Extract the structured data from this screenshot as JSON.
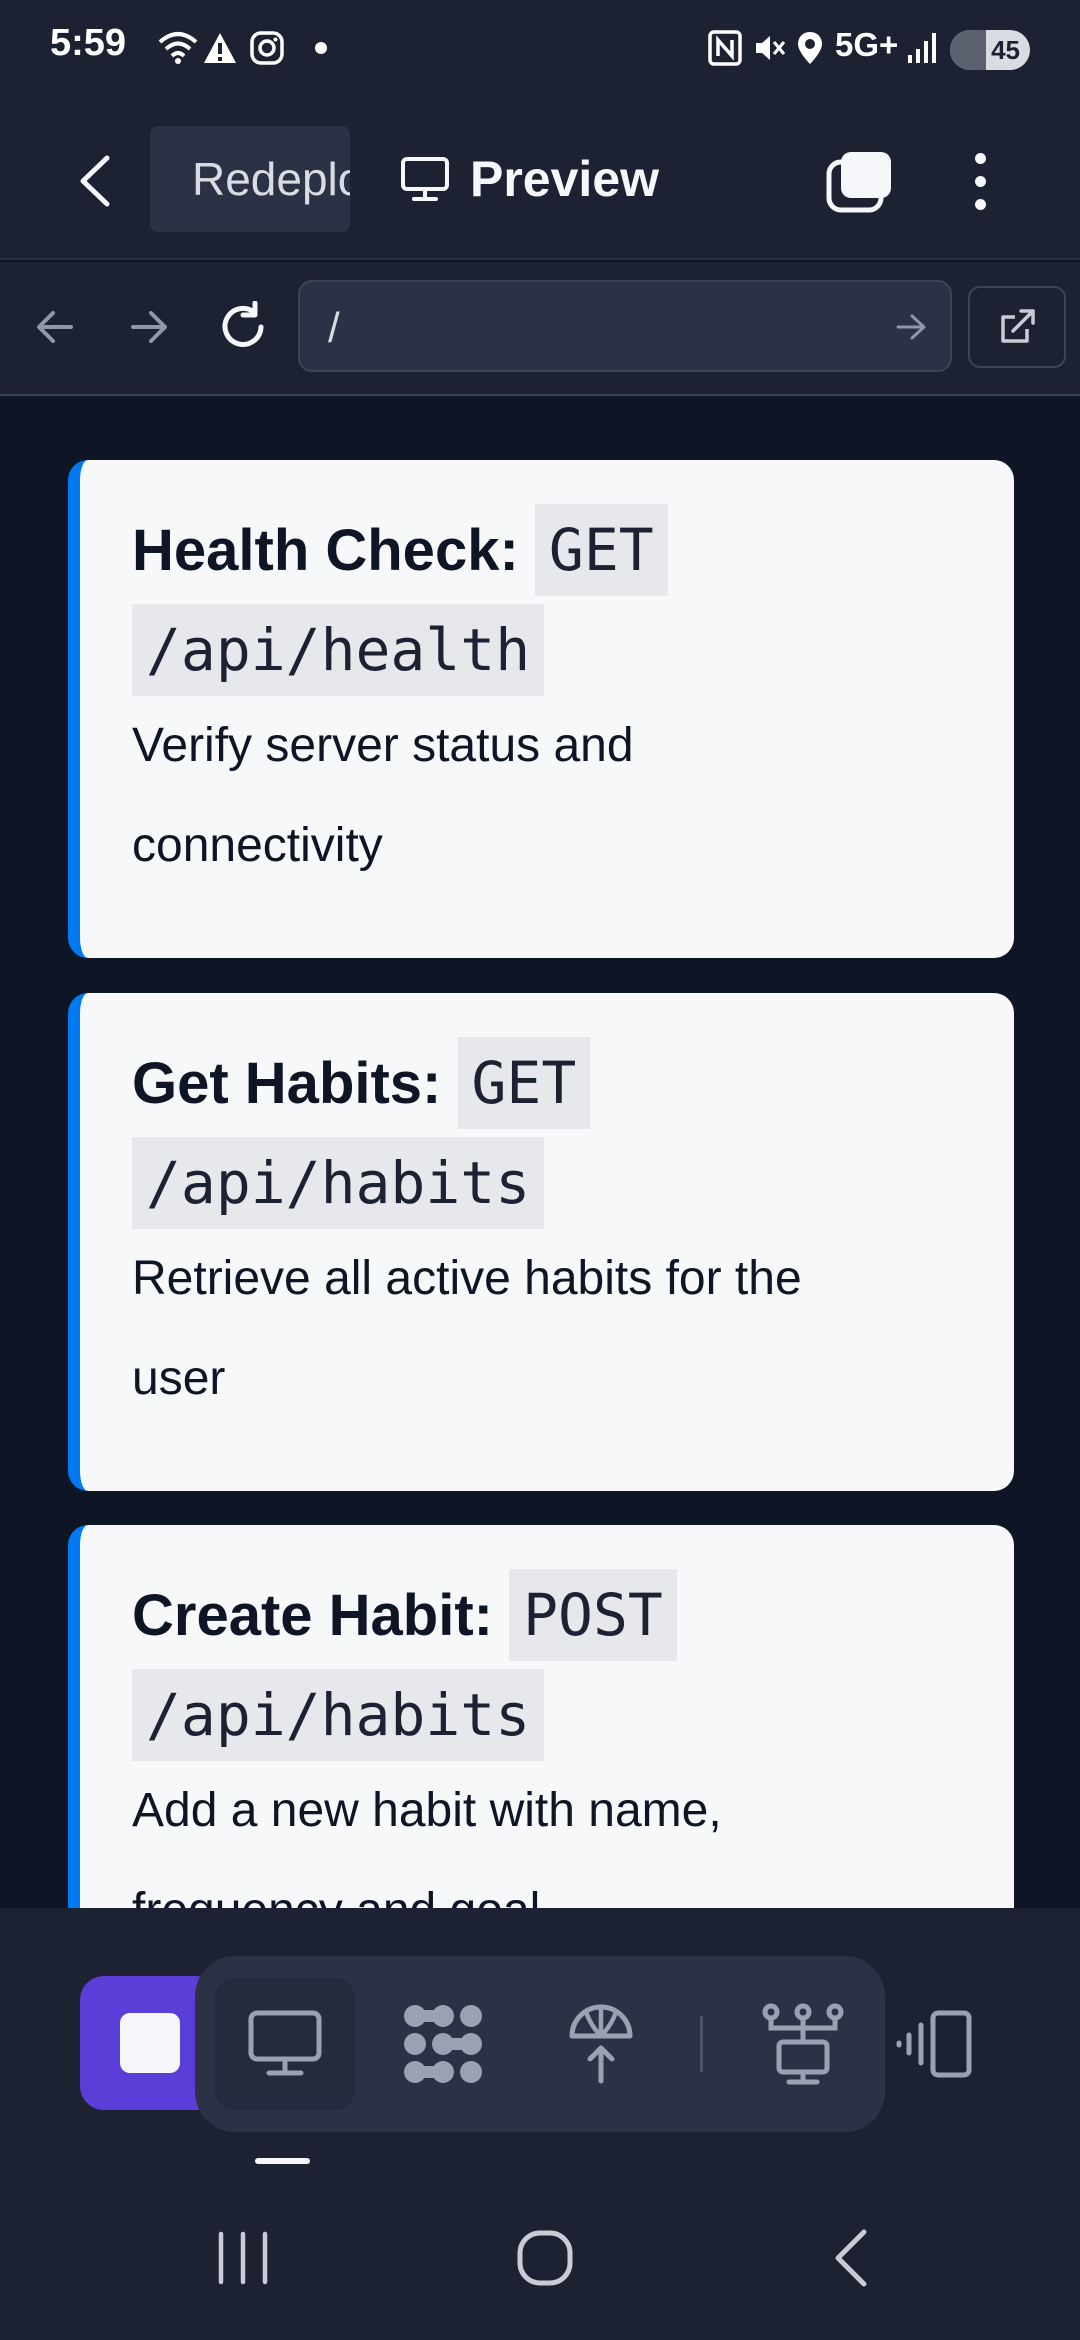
{
  "status_bar": {
    "time": "5:59",
    "network": "5G+",
    "battery": "45",
    "battery_level": 0.45,
    "icons": [
      "wifi-icon",
      "alert-icon",
      "instagram-icon",
      "notification-dot-icon",
      "nfc-icon",
      "mute-icon",
      "location-icon",
      "signal-icon",
      "battery-icon"
    ]
  },
  "header": {
    "tab_repl_label": "Redeploy",
    "tab_preview_label": "Preview",
    "icons": [
      "back-arrow-icon",
      "deploy-icon",
      "monitor-icon",
      "tabs-icon",
      "more-vertical-icon"
    ]
  },
  "browser": {
    "url": "/",
    "icons": [
      "back-icon",
      "forward-icon",
      "reload-icon",
      "go-arrow-icon",
      "open-external-icon"
    ]
  },
  "cards": [
    {
      "title": "Health Check:",
      "method": "GET",
      "path": "/api/health",
      "description": "Verify server status and connectivity"
    },
    {
      "title": "Get Habits:",
      "method": "GET",
      "path": "/api/habits",
      "description": "Retrieve all active habits for the user"
    },
    {
      "title": "Create Habit:",
      "method": "POST",
      "path": "/api/habits",
      "description": "Add a new habit with name, frequency and goal"
    }
  ],
  "toolbar": {
    "icons": [
      "stop-icon",
      "monitor-icon",
      "workflow-icon",
      "deploy-icon",
      "network-icon",
      "devices-icon"
    ]
  },
  "colors": {
    "accent": "#0079f2",
    "stop": "#5b3dd8",
    "background": "#0e1525",
    "surface": "#1c2232",
    "card": "#f7f8fa"
  }
}
